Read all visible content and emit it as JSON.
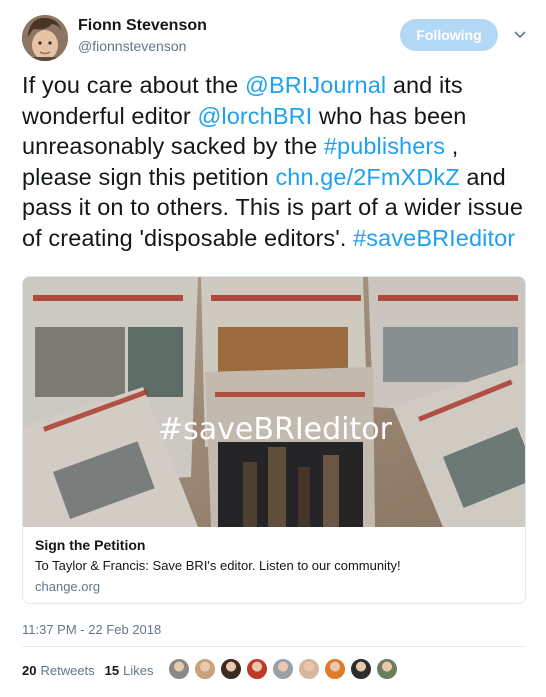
{
  "author": {
    "name": "Fionn Stevenson",
    "handle": "@fionnstevenson"
  },
  "follow_button": {
    "label": "Following"
  },
  "tweet": {
    "segments": [
      {
        "text": "If you care about the ",
        "link": false
      },
      {
        "text": "@BRIJournal",
        "link": true
      },
      {
        "text": " and its wonderful editor ",
        "link": false
      },
      {
        "text": "@lorchBRI",
        "link": true
      },
      {
        "text": " who has been unreasonably sacked by the ",
        "link": false
      },
      {
        "text": "#publishers",
        "link": true
      },
      {
        "text": " , please sign this petition ",
        "link": false
      },
      {
        "text": "chn.ge/2FmXDkZ",
        "link": true
      },
      {
        "text": " and pass it on to others. This is part of a wider issue of creating 'disposable editors'. ",
        "link": false
      },
      {
        "text": "#saveBRIeditor",
        "link": true
      }
    ]
  },
  "card": {
    "image_overlay_text": "#saveBRIeditor",
    "title": "Sign the Petition",
    "description": "To Taylor & Francis: Save BRI's editor. Listen to our community!",
    "domain": "change.org"
  },
  "timestamp": "11:37 PM - 22 Feb 2018",
  "stats": {
    "retweets_count": "20",
    "retweets_label": "Retweets",
    "likes_count": "15",
    "likes_label": "Likes"
  },
  "likers": [
    {
      "color": "#8a8a8a"
    },
    {
      "color": "#c9a27a"
    },
    {
      "color": "#3b2a20"
    },
    {
      "color": "#c0392b"
    },
    {
      "color": "#9aa0a6"
    },
    {
      "color": "#d8b49a"
    },
    {
      "color": "#e07b2a"
    },
    {
      "color": "#2d2d2d"
    },
    {
      "color": "#6b7d5a"
    }
  ],
  "colors": {
    "link": "#1da1f2",
    "follow_button_bg": "#b2d8f6",
    "secondary_text": "#657786"
  }
}
